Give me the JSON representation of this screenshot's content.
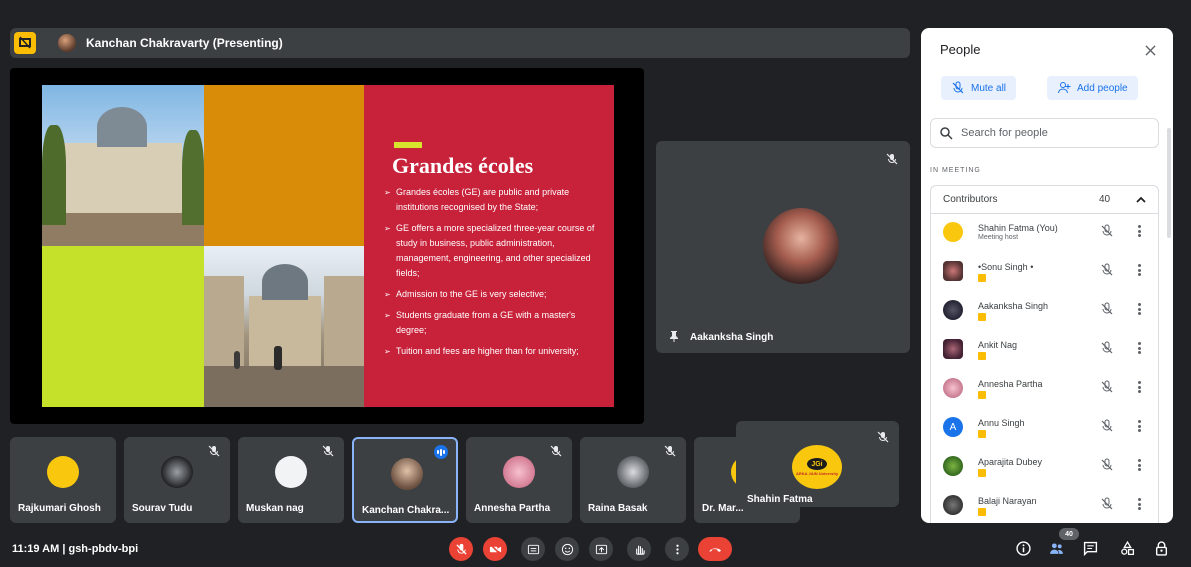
{
  "presenter_bar": {
    "name": "Kanchan Chakravarty (Presenting)"
  },
  "slide": {
    "title": "Grandes écoles",
    "bullets": [
      "Grandes écoles (GE) are public and private institutions recognised by the State;",
      "GE offers a more specialized three-year course of study in business, public administration, management, engineering, and other specialized fields;",
      "Admission to the GE is very selective;",
      "Students graduate from a GE with a master's degree;",
      "Tuition and fees are higher than for university;"
    ],
    "colors": {
      "panel": "#c8213a",
      "orange": "#d98c08",
      "lime": "#c6e12a",
      "accent": "#d7e32c"
    }
  },
  "pinned_tile": {
    "name": "Aakanksha Singh"
  },
  "tiles": [
    {
      "name": "Rajkumari Ghosh"
    },
    {
      "name": "Sourav Tudu"
    },
    {
      "name": "Muskan nag"
    },
    {
      "name": "Kanchan Chakra..."
    },
    {
      "name": "Annesha Partha"
    },
    {
      "name": "Raina Basak"
    },
    {
      "name": "Dr. Mar..."
    }
  ],
  "self_tile": {
    "name": "Shahin Fatma",
    "logo_text": "JGi",
    "logo_sub": "ARKA JAIN University"
  },
  "people_panel": {
    "title": "People",
    "mute_all": "Mute all",
    "add_people": "Add people",
    "search_placeholder": "Search for people",
    "section": "IN MEETING",
    "contributors_label": "Contributors",
    "contributors_count": "40",
    "participants": [
      {
        "name": "Shahin Fatma (You)",
        "sub": "Meeting host"
      },
      {
        "name": "•Sonu Singh •",
        "sub": ""
      },
      {
        "name": "Aakanksha Singh",
        "sub": ""
      },
      {
        "name": "Ankit Nag",
        "sub": ""
      },
      {
        "name": "Annesha Partha",
        "sub": ""
      },
      {
        "name": "Annu Singh",
        "sub": "",
        "initial": "A"
      },
      {
        "name": "Aparajita Dubey",
        "sub": ""
      },
      {
        "name": "Balaji Narayan",
        "sub": ""
      }
    ]
  },
  "bottom_bar": {
    "meeting_info": "11:19 AM  |  gsh-pbdv-bpi",
    "people_count": "40",
    "icons": [
      "mic-off",
      "camera-off",
      "captions",
      "emoji",
      "present",
      "raise-hand",
      "more",
      "end-call",
      "info",
      "people",
      "chat",
      "activities",
      "host-controls"
    ]
  }
}
